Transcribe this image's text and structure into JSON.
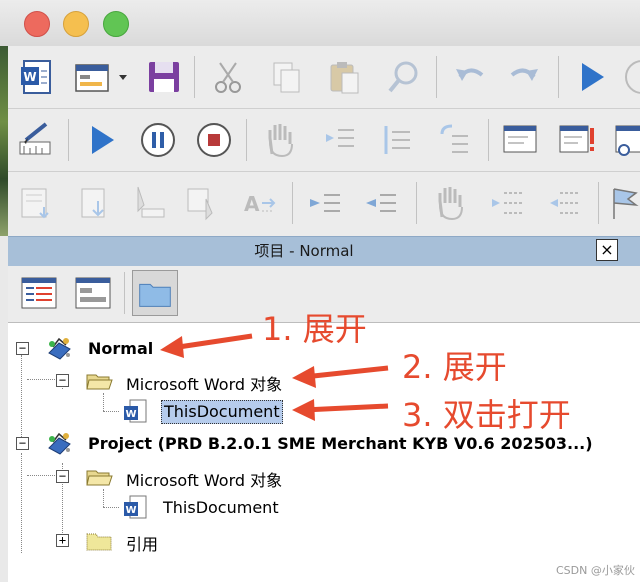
{
  "window": {
    "controls": [
      "close",
      "minimize",
      "zoom"
    ]
  },
  "toolbars": {
    "row1": [
      "word-icon",
      "insert-form-icon",
      "dropdown-arrow-icon",
      "save-icon",
      "cut-icon",
      "copy-icon",
      "paste-icon",
      "find-icon",
      "undo-icon",
      "redo-icon",
      "run-icon",
      "break-icon"
    ],
    "row2": [
      "design-mode-icon",
      "run-icon",
      "pause-icon",
      "stop-icon",
      "hand-icon",
      "indent-icon",
      "outdent-icon",
      "comment-icon",
      "project-explorer-icon",
      "properties-icon",
      "object-browser-icon"
    ],
    "row3": [
      "toggle-icon",
      "step-icon",
      "step-over-icon",
      "step-out-icon",
      "quick-info-icon",
      "indent-block-icon",
      "outdent-block-icon",
      "toggle-breakpoint-icon",
      "comment-block-icon",
      "uncomment-block-icon",
      "bookmark-icon"
    ]
  },
  "project_panel": {
    "title": "项目 - Normal",
    "close_label": "×",
    "tools": [
      "view-code-icon",
      "view-object-icon",
      "toggle-folders-icon"
    ]
  },
  "tree": {
    "normal": {
      "label": "Normal",
      "expander": "−",
      "word_objects": {
        "label": "Microsoft Word 对象",
        "expander": "−",
        "this_document": "ThisDocument"
      }
    },
    "project": {
      "label": "Project (PRD B.2.0.1 SME Merchant KYB V0.6 202503...)",
      "expander": "−",
      "word_objects": {
        "label": "Microsoft Word 对象",
        "expander": "−",
        "this_document": "ThisDocument"
      },
      "references": {
        "label": "引用",
        "expander": "+"
      }
    }
  },
  "annotations": {
    "step1": "1. 展开",
    "step2": "2. 展开",
    "step3": "3. 双击打开",
    "color": "#e64a2e"
  },
  "watermark": "CSDN @小家伙"
}
